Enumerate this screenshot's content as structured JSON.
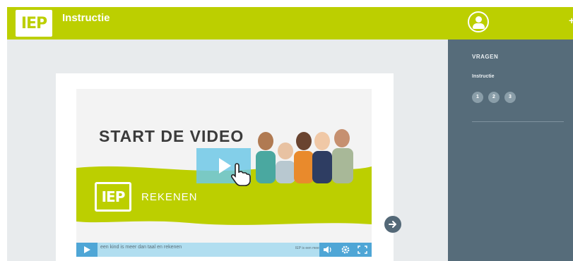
{
  "header": {
    "logo_text": "IEP",
    "title": "Instructie",
    "user_icon": "user-circle-icon"
  },
  "video": {
    "headline": "START DE VIDEO",
    "brand_logo_text": "IEP",
    "brand_word": "REKENEN",
    "caption": "een kind is meer dan taal en rekenen",
    "caption_right": "IEP is een mee",
    "controls": [
      "play-icon",
      "volume-icon",
      "settings-icon",
      "fullscreen-icon"
    ]
  },
  "navigation": {
    "next_icon": "arrow-right-icon"
  },
  "sidebar": {
    "heading": "VRAGEN",
    "section": "Instructie",
    "questions": [
      "1",
      "2",
      "3"
    ]
  },
  "colors": {
    "brand_green": "#bccf00",
    "sidebar": "#566c7a",
    "question_circle": "#8a9ea9",
    "video_controls": "#4fa6d6"
  }
}
